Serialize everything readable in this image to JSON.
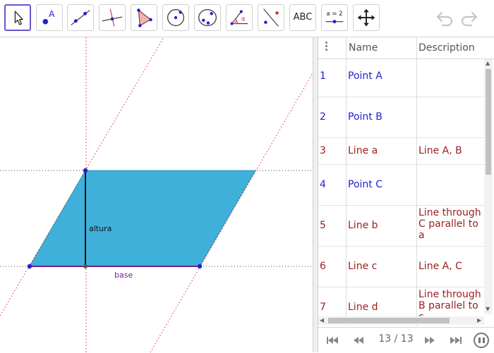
{
  "toolbar": {
    "tools": [
      {
        "name": "move-tool",
        "icon": "arrow-cursor-icon",
        "selected": true
      },
      {
        "name": "point-tool",
        "icon": "point-icon",
        "label": "A"
      },
      {
        "name": "line-tool",
        "icon": "line-through-points-icon"
      },
      {
        "name": "perpendicular-tool",
        "icon": "perpendicular-line-icon"
      },
      {
        "name": "polygon-tool",
        "icon": "polygon-icon"
      },
      {
        "name": "circle-tool",
        "icon": "circle-center-point-icon"
      },
      {
        "name": "conic-tool",
        "icon": "ellipse-icon"
      },
      {
        "name": "angle-tool",
        "icon": "angle-icon",
        "label": "α"
      },
      {
        "name": "reflect-tool",
        "icon": "reflect-about-line-icon"
      },
      {
        "name": "text-tool",
        "icon": "text-icon",
        "label": "ABC"
      },
      {
        "name": "slider-tool",
        "icon": "slider-icon",
        "label": "a = 2"
      },
      {
        "name": "move-graphics-tool",
        "icon": "move-arrows-icon"
      }
    ],
    "undo_icon": "undo-icon",
    "redo_icon": "redo-icon"
  },
  "graphics": {
    "labels": {
      "altura": "altura",
      "base": "base"
    },
    "colors": {
      "fill": "#3fb0d9",
      "base_segment": "#7a1b8c",
      "dotted": "#d8322f",
      "point": "#1e22d2"
    }
  },
  "protocol": {
    "headers": {
      "name": "Name",
      "description": "Description"
    },
    "rows": [
      {
        "num": "1",
        "name": "Point A",
        "description": "",
        "color": "blue"
      },
      {
        "num": "2",
        "name": "Point B",
        "description": "",
        "color": "blue"
      },
      {
        "num": "3",
        "name": "Line a",
        "description": "Line A, B",
        "color": "red"
      },
      {
        "num": "4",
        "name": "Point C",
        "description": "",
        "color": "blue"
      },
      {
        "num": "5",
        "name": "Line b",
        "description": "Line through C parallel to a",
        "color": "red"
      },
      {
        "num": "6",
        "name": "Line c",
        "description": "Line A, C",
        "color": "red"
      },
      {
        "num": "7",
        "name": "Line d",
        "description": "Line through B parallel to c",
        "color": "red"
      }
    ]
  },
  "navigation": {
    "step": "13 / 13",
    "icons": [
      "first-step-icon",
      "previous-step-icon",
      "next-step-icon",
      "last-step-icon",
      "pause-icon"
    ]
  }
}
